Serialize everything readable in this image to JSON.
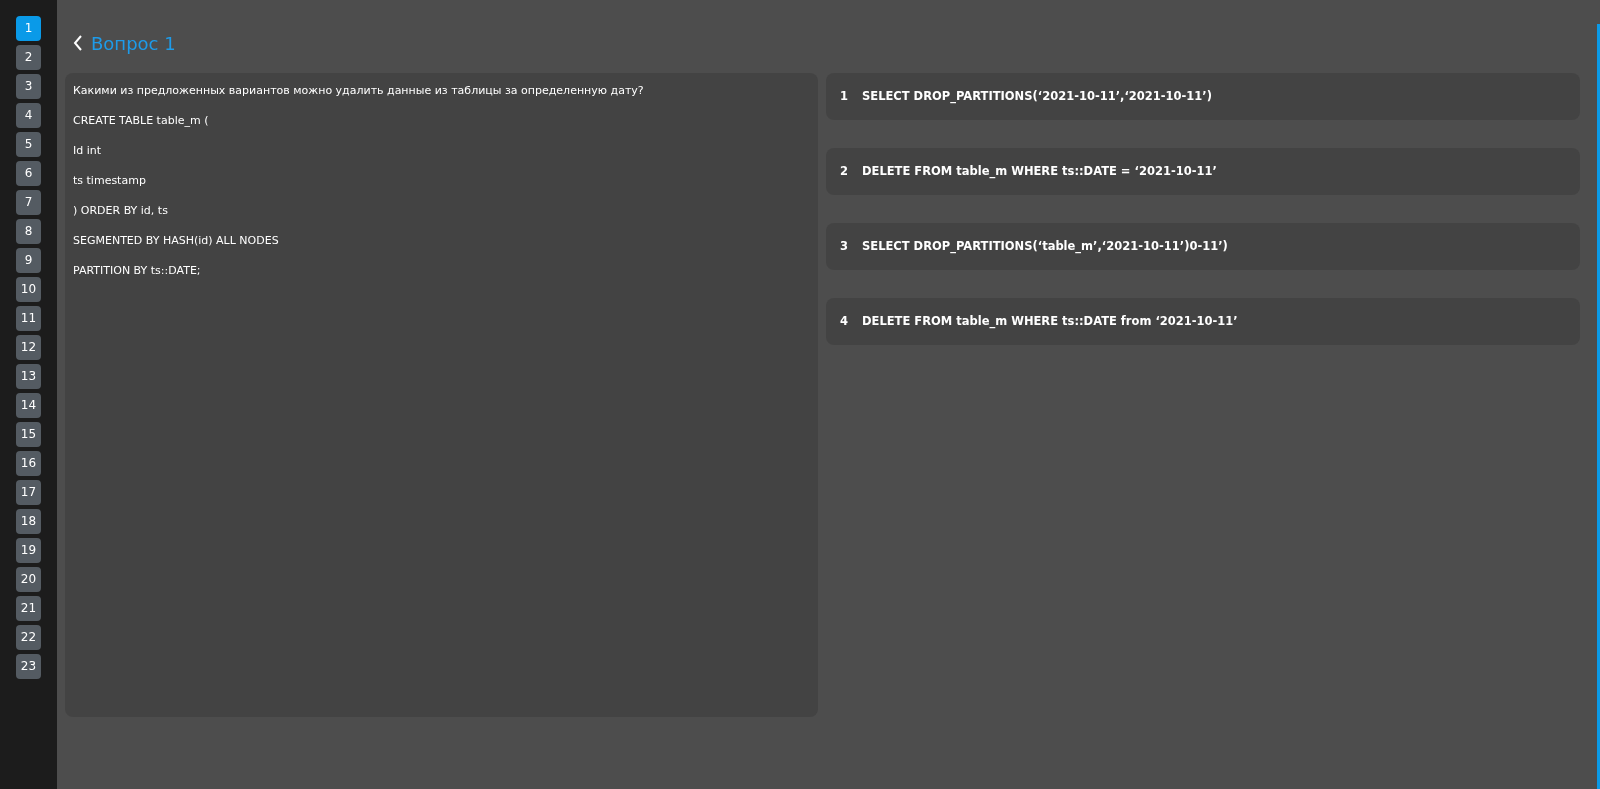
{
  "sidebar": {
    "items": [
      {
        "label": "1",
        "selected": true
      },
      {
        "label": "2",
        "selected": false
      },
      {
        "label": "3",
        "selected": false
      },
      {
        "label": "4",
        "selected": false
      },
      {
        "label": "5",
        "selected": false
      },
      {
        "label": "6",
        "selected": false
      },
      {
        "label": "7",
        "selected": false
      },
      {
        "label": "8",
        "selected": false
      },
      {
        "label": "9",
        "selected": false
      },
      {
        "label": "10",
        "selected": false
      },
      {
        "label": "11",
        "selected": false
      },
      {
        "label": "12",
        "selected": false
      },
      {
        "label": "13",
        "selected": false
      },
      {
        "label": "14",
        "selected": false
      },
      {
        "label": "15",
        "selected": false
      },
      {
        "label": "16",
        "selected": false
      },
      {
        "label": "17",
        "selected": false
      },
      {
        "label": "18",
        "selected": false
      },
      {
        "label": "19",
        "selected": false
      },
      {
        "label": "20",
        "selected": false
      },
      {
        "label": "21",
        "selected": false
      },
      {
        "label": "22",
        "selected": false
      },
      {
        "label": "23",
        "selected": false
      }
    ]
  },
  "header": {
    "title": "Вопрос 1"
  },
  "question": {
    "lines": [
      "Какими из предложенных вариантов можно удалить данные из таблицы за определенную дату?",
      "CREATE TABLE table_m (",
      "Id int",
      "ts timestamp",
      ") ORDER BY id, ts",
      "SEGMENTED BY HASH(id) ALL NODES",
      "PARTITION BY ts::DATE;"
    ]
  },
  "answers": [
    {
      "number": "1",
      "text": "SELECT DROP_PARTITIONS(‘2021-10-11’,‘2021-10-11’)"
    },
    {
      "number": "2",
      "text": "DELETE FROM table_m WHERE ts::DATE = ‘2021-10-11’"
    },
    {
      "number": "3",
      "text": "SELECT DROP_PARTITIONS(‘table_m’,‘2021-10-11’)0-11’)"
    },
    {
      "number": "4",
      "text": "DELETE FROM table_m WHERE ts::DATE from ‘2021-10-11’"
    }
  ]
}
